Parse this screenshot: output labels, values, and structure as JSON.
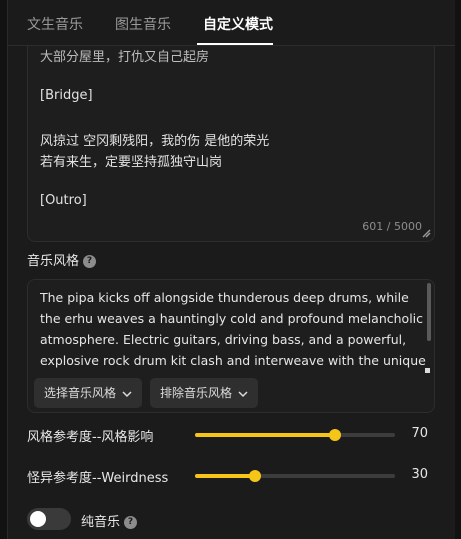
{
  "tabs": [
    {
      "label": "文生音乐",
      "active": false
    },
    {
      "label": "图生音乐",
      "active": false
    },
    {
      "label": "自定义模式",
      "active": true
    }
  ],
  "lyrics": {
    "lines": [
      "大部分屋里，打仇又自己起房",
      "",
      "[Bridge]",
      "",
      "风掠过 空冈剩残阳，我的伤 是他的荣光",
      "若有来生，定要坚持孤独守山岗",
      "",
      "[Outro]"
    ],
    "char_count": "601 / 5000"
  },
  "music_style": {
    "label": "音乐风格",
    "help_icon": "question-circle-icon",
    "text": "The pipa kicks off alongside thunderous deep drums, while the erhu weaves a hauntingly cold and profound melancholic atmosphere. Electric guitars, driving bass, and a powerful, explosive rock drum kit clash and interweave with the unique",
    "select_button": "选择音乐风格",
    "exclude_button": "排除音乐风格"
  },
  "sliders": [
    {
      "label": "风格参考度--风格影响",
      "value": 70,
      "max": 100
    },
    {
      "label": "怪异参考度--Weirdness",
      "value": 30,
      "max": 100
    }
  ],
  "instrumental": {
    "label": "纯音乐",
    "enabled": false,
    "help_icon": "question-circle-icon"
  },
  "colors": {
    "accent": "#f5c518",
    "background": "#1b1b1b"
  }
}
